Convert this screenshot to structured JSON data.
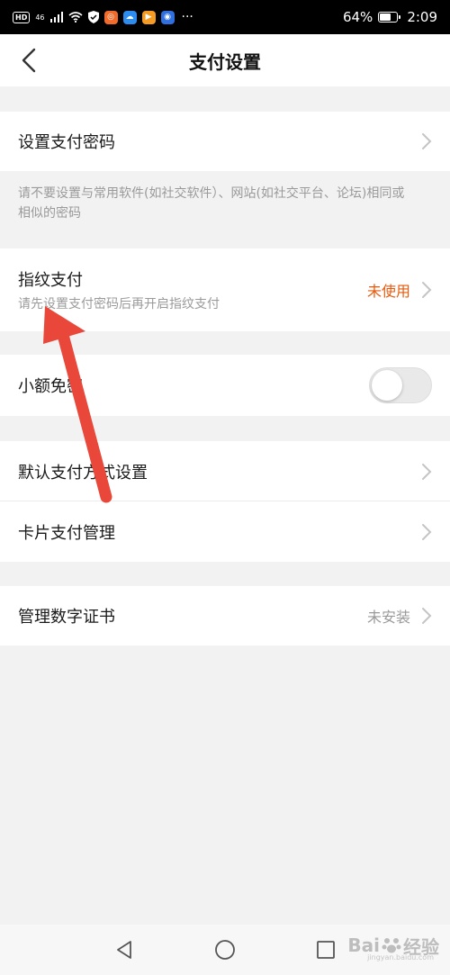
{
  "status_bar": {
    "badge": "HD",
    "signal": "46",
    "battery_percent": "64%",
    "battery_level": 0.64,
    "time": "2:09",
    "dots": "···"
  },
  "header": {
    "title": "支付设置"
  },
  "settings": {
    "set_password": {
      "label": "设置支付密码"
    },
    "password_hint": "请不要设置与常用软件(如社交软件）、网站(如社交平台、论坛)相同或相似的密码",
    "fingerprint": {
      "label": "指纹支付",
      "sub": "请先设置支付密码后再开启指纹支付",
      "value": "未使用",
      "value_color": "#e8590c"
    },
    "small_free": {
      "label": "小额免密",
      "enabled": false
    },
    "default_method": {
      "label": "默认支付方式设置"
    },
    "card_manage": {
      "label": "卡片支付管理"
    },
    "certificate": {
      "label": "管理数字证书",
      "value": "未安装",
      "value_color": "#9a9a9a"
    }
  },
  "colors": {
    "accent_orange": "#e8590c",
    "annotation_arrow": "#e8473a",
    "page_bg": "#f2f2f2"
  },
  "watermark": {
    "brand": "Bai",
    "brand_suffix": "经验",
    "url": "jingyan.baidu.com"
  }
}
